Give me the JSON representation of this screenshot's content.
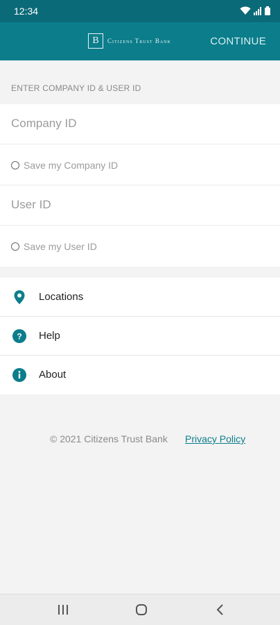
{
  "status_bar": {
    "time": "12:34"
  },
  "header": {
    "logo_text": "Citizens Trust Bank",
    "continue_label": "CONTINUE"
  },
  "form": {
    "section_label": "ENTER COMPANY ID & USER ID",
    "company_id_placeholder": "Company ID",
    "save_company_id_label": "Save my Company ID",
    "user_id_placeholder": "User ID",
    "save_user_id_label": "Save my User ID"
  },
  "menu": {
    "items": [
      {
        "label": "Locations",
        "icon": "location-pin-icon"
      },
      {
        "label": "Help",
        "icon": "help-icon"
      },
      {
        "label": "About",
        "icon": "info-icon"
      }
    ]
  },
  "footer": {
    "copyright": "© 2021 Citizens Trust Bank",
    "privacy_link": "Privacy Policy"
  },
  "colors": {
    "brand_teal": "#0c7d8b",
    "status_bar": "#0b6a78"
  }
}
